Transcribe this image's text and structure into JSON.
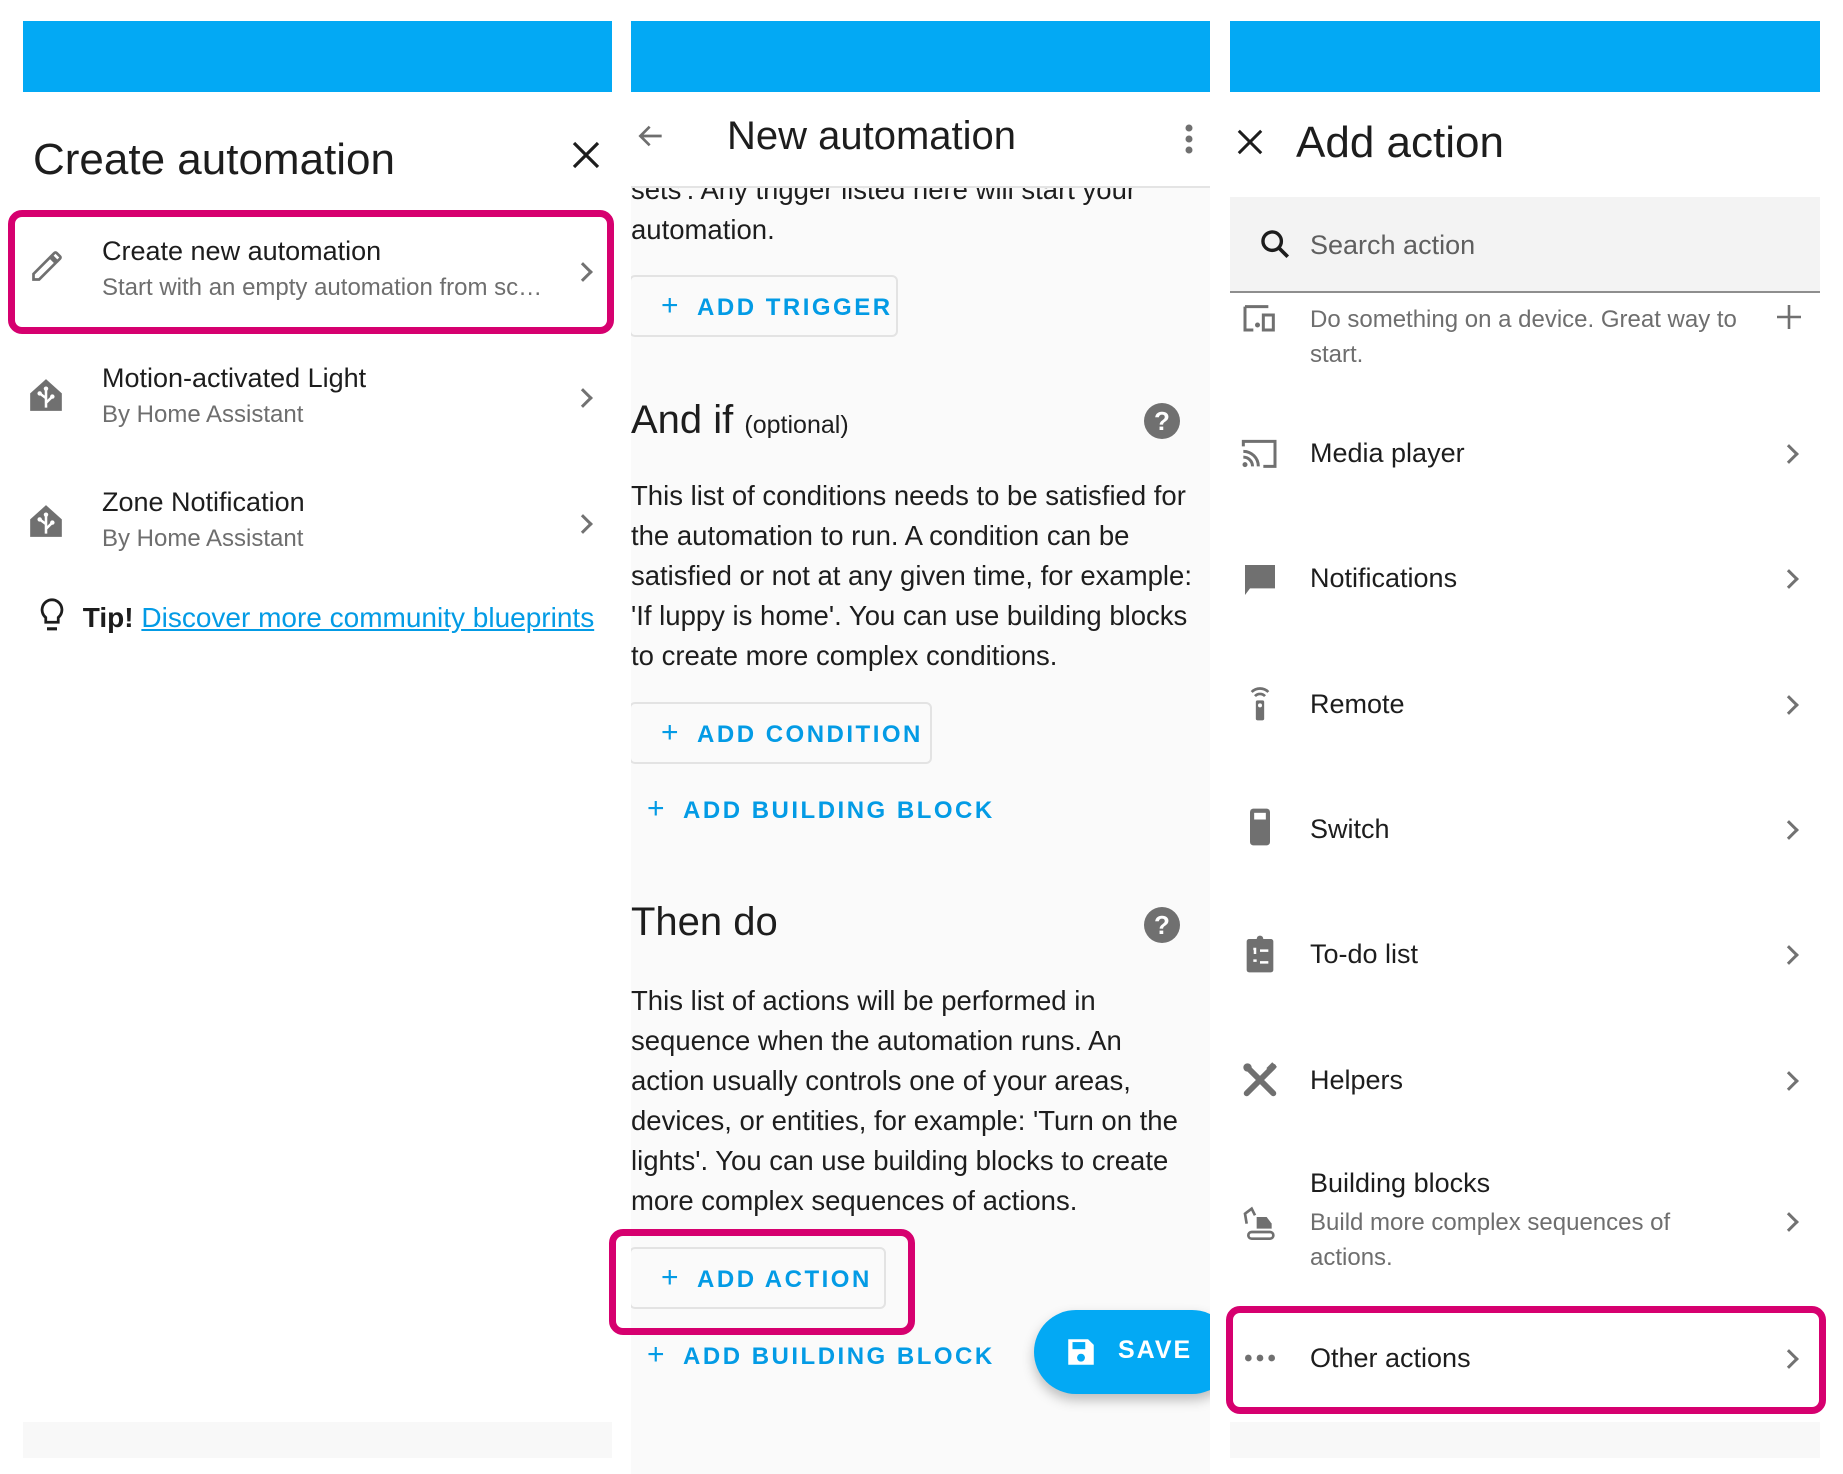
{
  "colors": {
    "header_blue": "#03a9f4",
    "highlight": "#d6006f",
    "link": "#039be5",
    "icon_gray": "#707070"
  },
  "panel1": {
    "title": "Create automation",
    "close_icon": "close-icon",
    "items": [
      {
        "icon": "pencil-icon",
        "title": "Create new automation",
        "subtitle": "Start with an empty automation from sc…",
        "highlighted": true
      },
      {
        "icon": "home-assistant-blueprint-icon",
        "title": "Motion-activated Light",
        "subtitle": "By Home Assistant"
      },
      {
        "icon": "home-assistant-blueprint-icon",
        "title": "Zone Notification",
        "subtitle": "By Home Assistant"
      }
    ],
    "tip": {
      "icon": "lightbulb-icon",
      "label": "Tip!",
      "link": "Discover more community blueprints"
    }
  },
  "panel2": {
    "title": "New automation",
    "back_icon": "arrow-left-icon",
    "menu_icon": "dots-vertical-icon",
    "trigger_desc_cutoff": "sets'. Any trigger listed here will start your",
    "trigger_desc_end": "automation.",
    "add_trigger": "ADD TRIGGER",
    "conditions": {
      "title": "And if",
      "optional": "(optional)",
      "lines": [
        "This list of conditions needs to be satisfied for",
        "the automation to run. A condition can be",
        "satisfied or not at any given time, for example:",
        "'If luppy is home'. You can use building blocks",
        "to create more complex conditions."
      ],
      "add_condition": "ADD CONDITION",
      "add_building_block": "ADD BUILDING BLOCK"
    },
    "actions": {
      "title": "Then do",
      "lines": [
        "This list of actions will be performed in",
        "sequence when the automation runs. An",
        "action usually controls one of your areas,",
        "devices, or entities, for example: 'Turn on the",
        "lights'. You can use building blocks to create",
        "more complex sequences of actions."
      ],
      "add_action": "ADD ACTION",
      "add_building_block": "ADD BUILDING BLOCK"
    },
    "save": "SAVE"
  },
  "panel3": {
    "title": "Add action",
    "search_placeholder": "Search action",
    "device": {
      "icon": "devices-icon",
      "text_line1": "Do something on a device. Great way to",
      "text_line2": "start."
    },
    "items": [
      {
        "icon": "cast-icon",
        "label": "Media player"
      },
      {
        "icon": "message-icon",
        "label": "Notifications"
      },
      {
        "icon": "remote-icon",
        "label": "Remote"
      },
      {
        "icon": "switch-icon",
        "label": "Switch"
      },
      {
        "icon": "clipboard-list-icon",
        "label": "To-do list"
      },
      {
        "icon": "tools-icon",
        "label": "Helpers"
      }
    ],
    "building_blocks": {
      "icon": "excavator-icon",
      "label": "Building blocks",
      "subtitle_line1": "Build more complex sequences of",
      "subtitle_line2": "actions."
    },
    "other_actions": {
      "icon": "dots-horizontal-icon",
      "label": "Other actions",
      "highlighted": true
    }
  }
}
